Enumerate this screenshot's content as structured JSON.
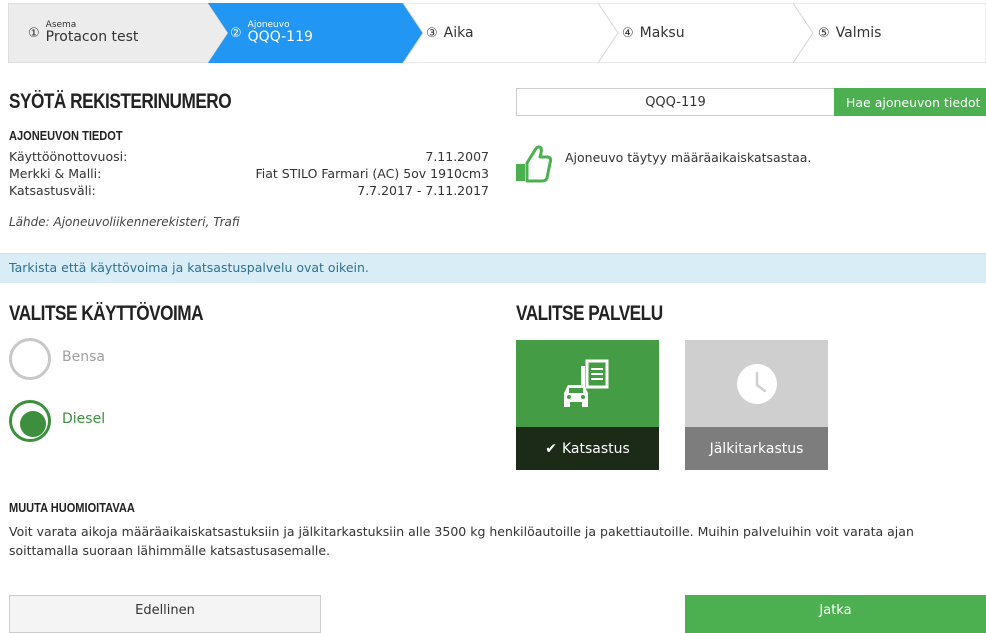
{
  "stepper": {
    "steps": [
      {
        "number": "①",
        "small": "Asema",
        "label": "Protacon test"
      },
      {
        "number": "②",
        "small": "Ajoneuvo",
        "label": "QQQ-119"
      },
      {
        "number": "③",
        "label": "Aika"
      },
      {
        "number": "④",
        "label": "Maksu"
      },
      {
        "number": "⑤",
        "label": "Valmis"
      }
    ],
    "active_color": "#2196f3",
    "inactive_color": "#ececec"
  },
  "registration": {
    "title": "SYÖTÄ REKISTERINUMERO",
    "input_value": "QQQ-119",
    "search_button": "Hae ajoneuvon tiedot"
  },
  "vehicle": {
    "title": "AJONEUVON TIEDOT",
    "rows": [
      {
        "label": "Käyttöönottovuosi:",
        "value": "7.11.2007"
      },
      {
        "label": "Merkki & Malli:",
        "value": "Fiat STILO Farmari (AC) 5ov 1910cm3"
      },
      {
        "label": "Katsastusväli:",
        "value": "7.7.2017 - 7.11.2017"
      }
    ],
    "source": "Lähde: Ajoneuvoliikennerekisteri, Trafi"
  },
  "result": {
    "icon": "thumbs-up-icon",
    "text": "Ajoneuvo täytyy määräaikaiskatsastaa."
  },
  "alert": {
    "text": "Tarkista että käyttövoima ja katsastuspalvelu ovat oikein."
  },
  "fuel": {
    "title": "VALITSE KÄYTTÖVOIMA",
    "options": [
      {
        "label": "Bensa",
        "selected": false
      },
      {
        "label": "Diesel",
        "selected": true
      }
    ]
  },
  "service": {
    "title": "VALITSE PALVELU",
    "options": [
      {
        "label": "Katsastus",
        "icon": "car-document-icon",
        "selected": true,
        "check": "✔"
      },
      {
        "label": "Jälkitarkastus",
        "icon": "clock-icon",
        "selected": false
      }
    ]
  },
  "notes": {
    "title": "MUUTA HUOMIOITAVAA",
    "text": "Voit varata aikoja määräaikaiskatsastuksiin ja jälkitarkastuksiin alle 3500 kg henkilöautoille ja pakettiautoille. Muihin palveluihin voit varata ajan soittamalla suoraan lähimmälle katsastusasemalle."
  },
  "footer": {
    "prev": "Edellinen",
    "next": "Jatka"
  },
  "colors": {
    "green": "#4caf50",
    "dark_green": "#3d8f3d",
    "blue": "#2196f3",
    "alert_bg": "#d9edf7"
  }
}
